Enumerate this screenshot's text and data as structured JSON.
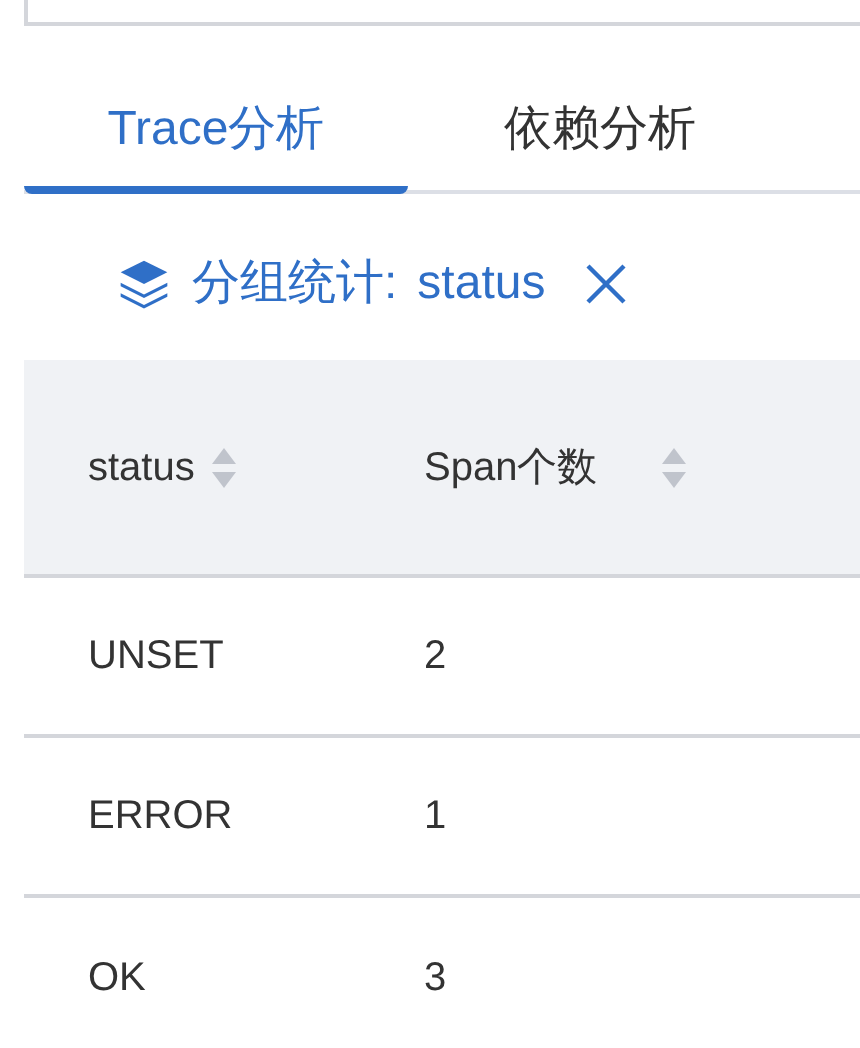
{
  "tabs": [
    {
      "label": "Trace分析",
      "selected": true
    },
    {
      "label": "依赖分析",
      "selected": false
    }
  ],
  "group_filter": {
    "label": "分组统计:",
    "value": "status"
  },
  "table": {
    "columns": [
      "status",
      "Span个数"
    ],
    "rows": [
      [
        "UNSET",
        "2"
      ],
      [
        "ERROR",
        "1"
      ],
      [
        "OK",
        "3"
      ]
    ]
  }
}
